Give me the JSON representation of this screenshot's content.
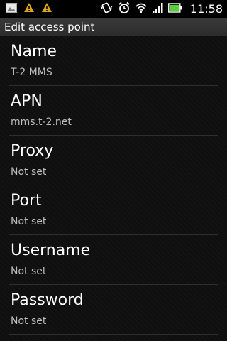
{
  "statusbar": {
    "left_icons": [
      "gallery-icon",
      "warning-icon",
      "warning-icon"
    ],
    "right_icons": [
      "vibrate-icon",
      "alarm-icon",
      "wifi-icon",
      "signal-icon",
      "battery-icon"
    ],
    "time": "11:58"
  },
  "header": {
    "title": "Edit access point"
  },
  "fields": [
    {
      "label": "Name",
      "value": "T-2 MMS"
    },
    {
      "label": "APN",
      "value": "mms.t-2.net"
    },
    {
      "label": "Proxy",
      "value": "Not set"
    },
    {
      "label": "Port",
      "value": "Not set"
    },
    {
      "label": "Username",
      "value": "Not set"
    },
    {
      "label": "Password",
      "value": "Not set"
    }
  ],
  "colors": {
    "warning": "#d9a51f",
    "battery": "#58d23b",
    "background": "#0f0f0f"
  }
}
